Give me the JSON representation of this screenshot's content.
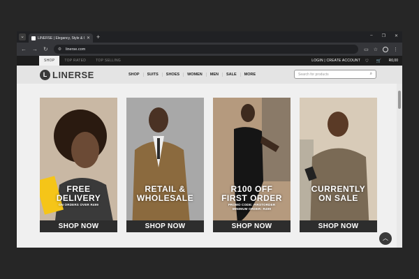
{
  "browser": {
    "tab_title": "LINERSE | Elegancy, Style & Co",
    "url": "linerse.com",
    "window_controls": [
      "–",
      "❐",
      "✕"
    ]
  },
  "topbar": {
    "tabs": [
      {
        "label": "SHOP",
        "active": true
      },
      {
        "label": "TOP RATED",
        "active": false
      },
      {
        "label": "TOP SELLING",
        "active": false
      }
    ],
    "account": "LOGIN | CREATE ACCOUNT",
    "cart_amount": "R0,00"
  },
  "header": {
    "logo_mark": "L",
    "logo_text": "LINERSE",
    "nav": [
      "SHOP",
      "SUITS",
      "SHOES",
      "WOMEN",
      "MEN",
      "SALE",
      "MORE"
    ],
    "search_placeholder": "Search for products"
  },
  "cards": [
    {
      "headline": "FREE DELIVERY",
      "sub": "ON ORDERS OVER R499",
      "sub2": "",
      "cta": "SHOP NOW",
      "bg": "#c9b8a4",
      "skin": "#6b4a35",
      "cloth": "#f5c518"
    },
    {
      "headline": "RETAIL & WHOLESALE",
      "sub": "",
      "sub2": "",
      "cta": "SHOP NOW",
      "bg": "#a8a8a8",
      "skin": "#4a3224",
      "cloth": "#8b6a3e"
    },
    {
      "headline": "R100 OFF FIRST ORDER",
      "sub": "PROMO CODE: FIRSTORDER",
      "sub2": "MINIMUM ORDER: R499",
      "cta": "SHOP NOW",
      "bg": "#b59a7e",
      "skin": "#3d2a1e",
      "cloth": "#151515"
    },
    {
      "headline": "CURRENTLY ON SALE",
      "sub": "",
      "sub2": "",
      "cta": "SHOP NOW",
      "bg": "#d8cbb8",
      "skin": "#5a3a26",
      "cloth": "#7a6a55"
    }
  ]
}
